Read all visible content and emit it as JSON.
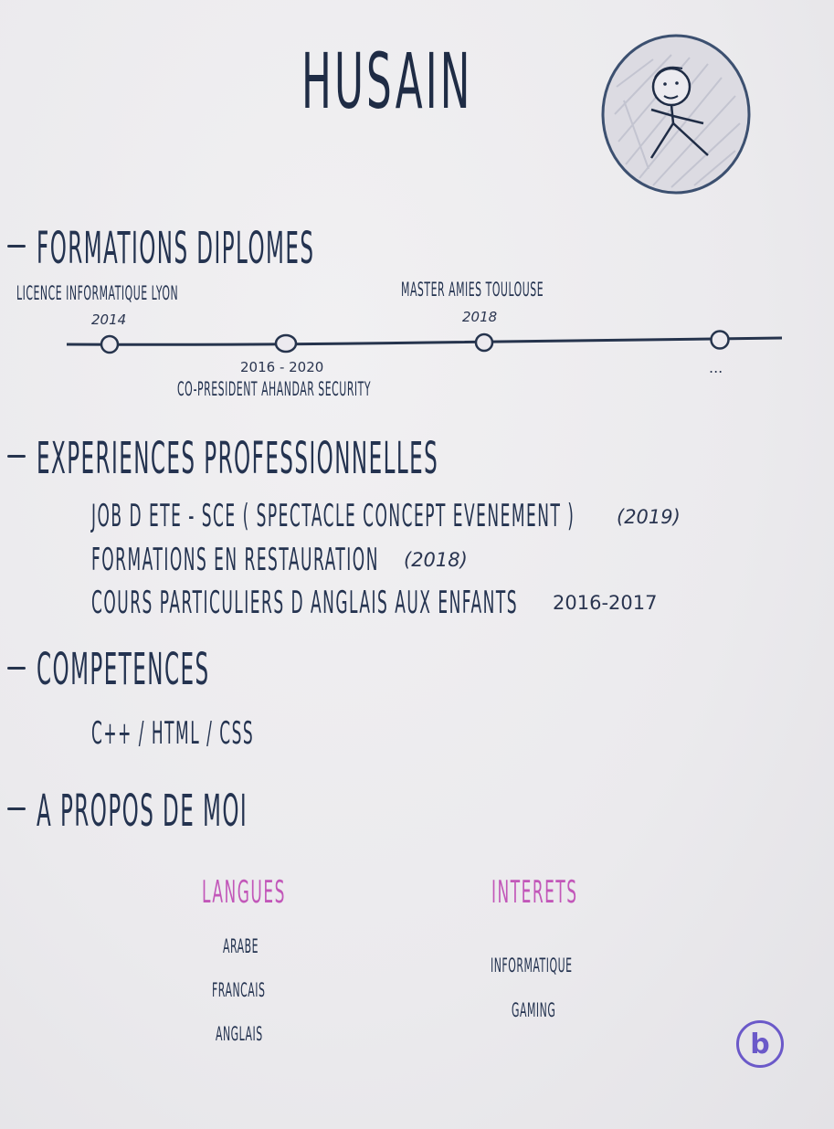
{
  "name": "HUSAIN",
  "formations": {
    "heading": "FORMATIONS DIPLOMES",
    "items": [
      {
        "label": "LICENCE INFORMATIQUE LYON",
        "year": "2014"
      },
      {
        "label": "CO-PRESIDENT AHANDAR SECURITY",
        "year": "2016 - 2020"
      },
      {
        "label": "MASTER AMIES TOULOUSE",
        "year": "2018"
      },
      {
        "label": "...",
        "year": ""
      }
    ]
  },
  "experiences": {
    "heading": "EXPERIENCES PROFESSIONNELLES",
    "items": [
      {
        "label": "JOB D ETE - SCE ( SPECTACLE CONCEPT EVENEMENT )",
        "year": "(2019)"
      },
      {
        "label": "FORMATIONS EN RESTAURATION",
        "year": "(2018)"
      },
      {
        "label": "COURS PARTICULIERS D ANGLAIS AUX ENFANTS",
        "year": "2016-2017"
      }
    ]
  },
  "competences": {
    "heading": "COMPETENCES",
    "items": "C++ / HTML / CSS"
  },
  "apropos": {
    "heading": "A PROPOS DE MOI",
    "langues": {
      "title": "LANGUES",
      "items": [
        "ARABE",
        "FRANCAIS",
        "ANGLAIS"
      ]
    },
    "interets": {
      "title": "INTERETS",
      "items": [
        "INFORMATIQUE",
        "GAMING"
      ]
    }
  },
  "badge": {
    "letter": "b"
  },
  "colors": {
    "ink": "#26344d",
    "accent": "#c257b9",
    "badge": "#6b59c9"
  },
  "icons": {
    "avatar": "stick-figure-doodle",
    "badge": "b-logo-icon"
  }
}
